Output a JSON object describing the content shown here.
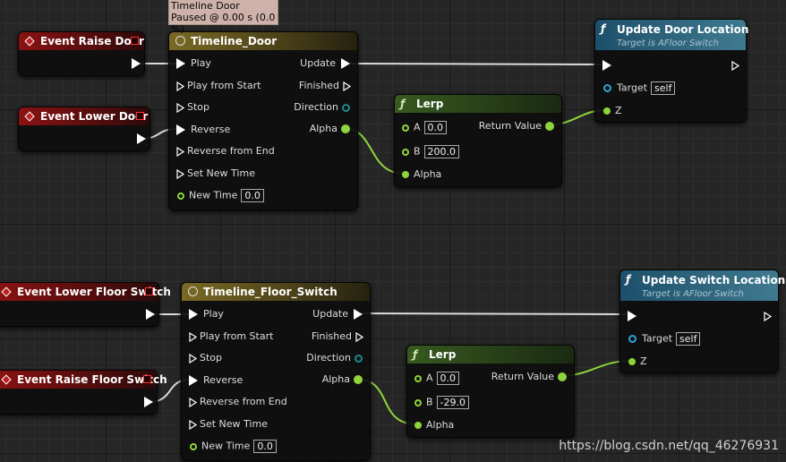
{
  "tooltip": {
    "line1": "Timeline Door",
    "line2": "Paused @ 0.00 s (0.0 %)"
  },
  "timeline_door": {
    "title": "Timeline_Door",
    "inputs": [
      "Play",
      "Play from Start",
      "Stop",
      "Reverse",
      "Reverse from End",
      "Set New Time"
    ],
    "new_time_label": "New Time",
    "new_time_value": "0.0",
    "outputs": {
      "update": "Update",
      "finished": "Finished",
      "direction": "Direction",
      "alpha": "Alpha"
    }
  },
  "timeline_floor": {
    "title": "Timeline_Floor_Switch",
    "inputs": [
      "Play",
      "Play from Start",
      "Stop",
      "Reverse",
      "Reverse from End",
      "Set New Time"
    ],
    "new_time_label": "New Time",
    "new_time_value": "0.0",
    "outputs": {
      "update": "Update",
      "finished": "Finished",
      "direction": "Direction",
      "alpha": "Alpha"
    }
  },
  "events": {
    "raise_door": "Event Raise Door",
    "lower_door": "Event Lower Door",
    "lower_floor_switch": "Event Lower Floor Switch",
    "raise_floor_switch": "Event Raise Floor Switch"
  },
  "lerp_door": {
    "title": "Lerp",
    "a_label": "A",
    "a_value": "0.0",
    "b_label": "B",
    "b_value": "200.0",
    "alpha_label": "Alpha",
    "return_label": "Return Value"
  },
  "lerp_switch": {
    "title": "Lerp",
    "a_label": "A",
    "a_value": "0.0",
    "b_label": "B",
    "b_value": "-29.0",
    "alpha_label": "Alpha",
    "return_label": "Return Value"
  },
  "update_door": {
    "title": "Update Door Location",
    "subtitle": "Target is AFloor Switch",
    "target_label": "Target",
    "target_value": "self",
    "z_label": "Z"
  },
  "update_switch": {
    "title": "Update Switch Location",
    "subtitle": "Target is AFloor Switch",
    "target_label": "Target",
    "target_value": "self",
    "z_label": "Z"
  },
  "watermark": "https://blog.csdn.net/qq_46276931",
  "colors": {
    "exec_wire": "#ffffff",
    "float_wire": "#8fd43c",
    "event_header": "#8a1212",
    "timeline_header": "#7a6a25",
    "function_header": "#3f7a90"
  }
}
